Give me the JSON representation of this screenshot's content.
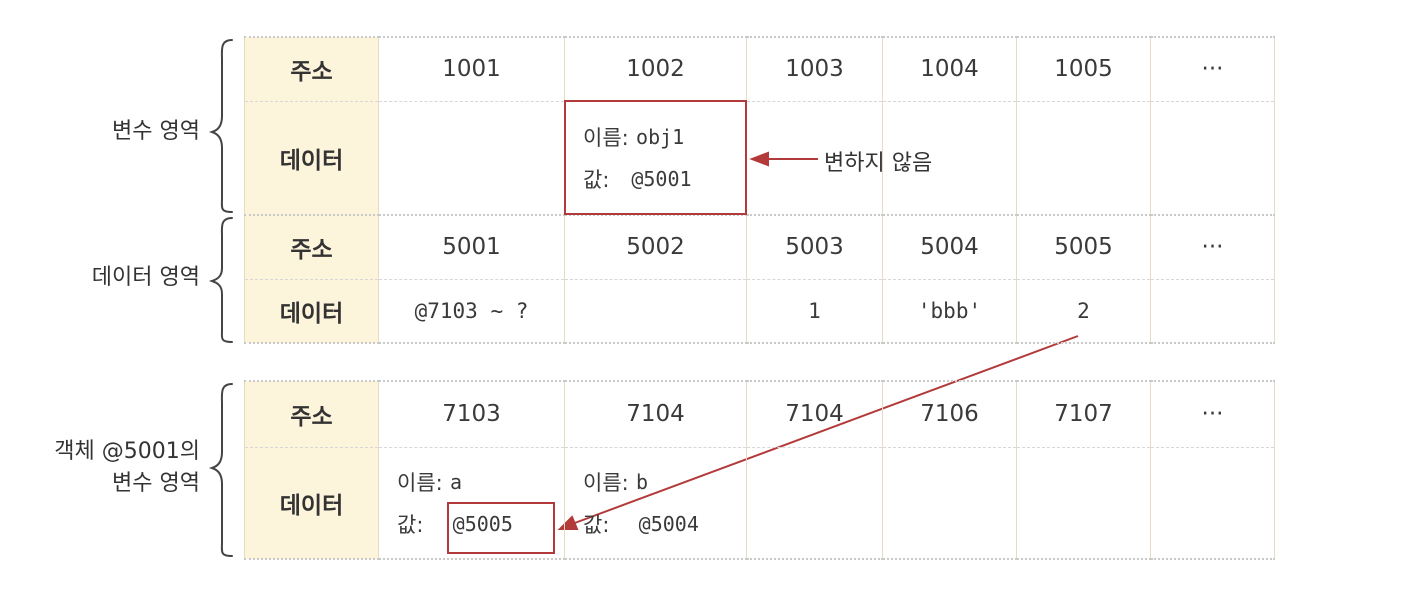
{
  "groups": {
    "variable_area": "변수 영역",
    "data_area": "데이터 영역",
    "object_area_line1": "객체 @5001의",
    "object_area_line2": "변수 영역"
  },
  "row_headers": {
    "address": "주소",
    "data": "데이터"
  },
  "table1": {
    "addresses": [
      "1001",
      "1002",
      "1003",
      "1004",
      "1005",
      "···"
    ],
    "cell_1002": {
      "name_label": "이름:",
      "name_value": "obj1",
      "value_label": "값:",
      "value_value": "@5001"
    }
  },
  "table2": {
    "addresses": [
      "5001",
      "5002",
      "5003",
      "5004",
      "5005",
      "···"
    ],
    "data": [
      "@7103 ~ ?",
      "",
      "1",
      "'bbb'",
      "2",
      ""
    ]
  },
  "table3": {
    "addresses": [
      "7103",
      "7104",
      "7104",
      "7106",
      "7107",
      "···"
    ],
    "cell_7103": {
      "name_label": "이름:",
      "name_value": "a",
      "value_label": "값:",
      "value_value": "@5005"
    },
    "cell_7104": {
      "name_label": "이름:",
      "name_value": "b",
      "value_label": "값:",
      "value_value": "@5004"
    }
  },
  "note": "변하지 않음",
  "colors": {
    "header_bg": "#fdf4dc",
    "accent_red": "#b33a3a"
  }
}
